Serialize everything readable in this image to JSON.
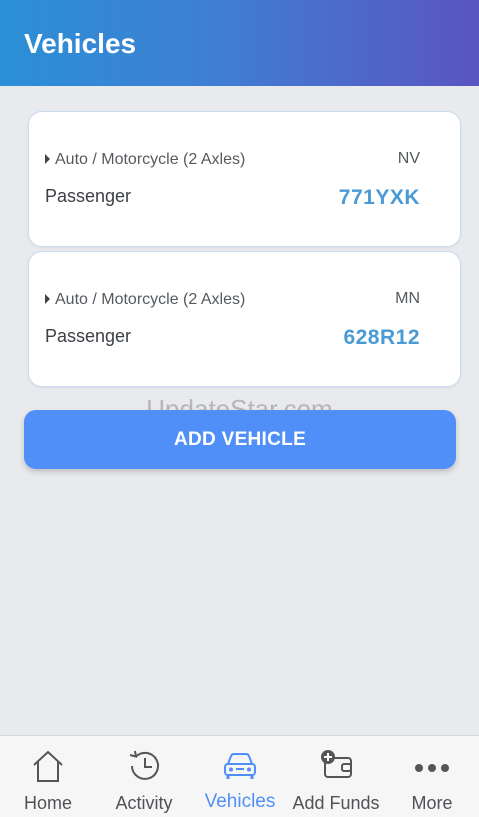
{
  "header": {
    "title": "Vehicles"
  },
  "vehicles": [
    {
      "type": "Auto / Motorcycle (2 Axles)",
      "state": "NV",
      "class": "Passenger",
      "plate": "771YXK"
    },
    {
      "type": "Auto / Motorcycle (2 Axles)",
      "state": "MN",
      "class": "Passenger",
      "plate": "628R12"
    }
  ],
  "actions": {
    "add_vehicle_label": "ADD VEHICLE"
  },
  "watermark": "UpdateStar.com",
  "tabs": [
    {
      "label": "Home",
      "icon": "home-icon"
    },
    {
      "label": "Activity",
      "icon": "history-icon"
    },
    {
      "label": "Vehicles",
      "icon": "car-icon",
      "active": true
    },
    {
      "label": "Add Funds",
      "icon": "wallet-add-icon"
    },
    {
      "label": "More",
      "icon": "more-dots-icon"
    }
  ],
  "colors": {
    "accent": "#4f8ff7",
    "plate": "#4a9ad6",
    "header_start": "#2b8fd6",
    "header_end": "#5a55c0"
  }
}
